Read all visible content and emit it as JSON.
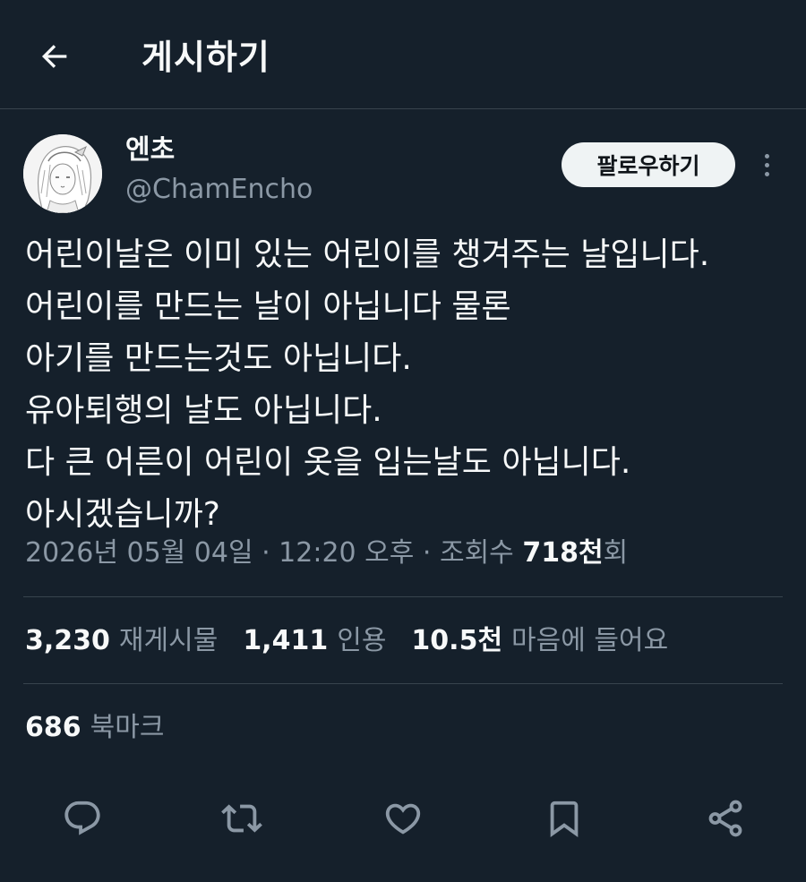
{
  "header": {
    "title": "게시하기",
    "back_icon": "arrow-left-icon"
  },
  "author": {
    "display_name": "엔초",
    "handle": "@ChamEncho",
    "avatar": "anime-character-avatar"
  },
  "follow_button": {
    "label": "팔로우하기"
  },
  "more_icon": "more-vertical-icon",
  "tweet": {
    "lines": [
      "어린이날은 이미 있는 어린이를 챙겨주는 날입니다.",
      "어린이를 만드는 날이 아닙니다 물론",
      "아기를 만드는것도 아닙니다.",
      "유아퇴행의 날도 아닙니다.",
      "다 큰 어른이 어린이 옷을 입는날도 아닙니다.",
      "아시겠습니까?"
    ]
  },
  "meta": {
    "timestamp": "2026년 05월 04일 · 12:20 오후",
    "separator": " · ",
    "views_label_pre": "조회수 ",
    "views_count": "718천",
    "views_label_post": "회"
  },
  "stats": {
    "reposts": {
      "count": "3,230",
      "label": "재게시물"
    },
    "quotes": {
      "count": "1,411",
      "label": "인용"
    },
    "likes": {
      "count": "10.5천",
      "label": "마음에 들어요"
    },
    "bookmarks": {
      "count": "686",
      "label": "북마크"
    }
  },
  "actions": [
    {
      "name": "reply",
      "icon": "reply-bubble-icon"
    },
    {
      "name": "repost",
      "icon": "repost-icon"
    },
    {
      "name": "like",
      "icon": "heart-icon"
    },
    {
      "name": "bookmark",
      "icon": "bookmark-icon"
    },
    {
      "name": "share",
      "icon": "share-icon"
    }
  ],
  "colors": {
    "background": "#15202b",
    "text_primary": "#f7f9f9",
    "text_secondary": "#8b98a5",
    "divider": "#38444d",
    "follow_bg": "#eff3f4"
  }
}
